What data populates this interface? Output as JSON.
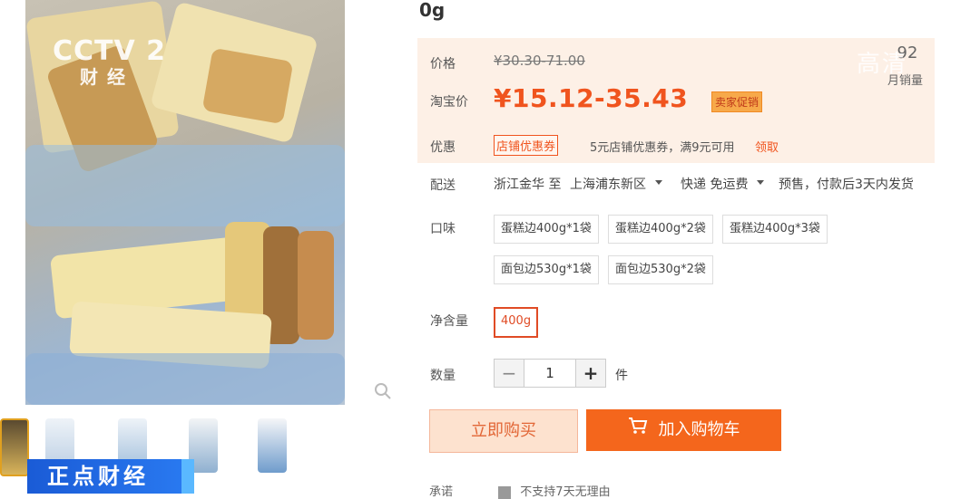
{
  "product": {
    "title_fragment": "0g"
  },
  "price": {
    "label": "价格",
    "original": "¥30.30-71.00",
    "taobao_label": "淘宝价",
    "taobao_price": "¥15.12-35.43",
    "seller_promo": "卖家促销"
  },
  "sales": {
    "count": "92",
    "label": "月销量"
  },
  "promotion": {
    "label": "优惠",
    "tag": "店铺优惠券",
    "description": "5元店铺优惠券，满9元可用",
    "claim": "领取"
  },
  "delivery": {
    "label": "配送",
    "from": "浙江金华 至",
    "to": "上海浦东新区",
    "method": "快递 免运费",
    "presale": "预售，付款后3天内发货"
  },
  "flavor": {
    "label": "口味",
    "options": [
      "蛋糕边400g*1袋",
      "蛋糕边400g*2袋",
      "蛋糕边400g*3袋",
      "面包边530g*1袋",
      "面包边530g*2袋"
    ]
  },
  "net_weight": {
    "label": "净含量",
    "options": [
      "400g"
    ]
  },
  "quantity": {
    "label": "数量",
    "value": "1",
    "unit": "件",
    "minus": "−",
    "plus": "+"
  },
  "actions": {
    "buy_now": "立即购买",
    "add_to_cart": "加入购物车"
  },
  "overlay": {
    "channel_logo": "CCTV 2",
    "channel_sub": "财经",
    "program_banner": "正点财经",
    "watermark": "高清"
  },
  "footer": {
    "commitment_label": "承诺",
    "return_policy": "不支持7天无理由"
  },
  "colors": {
    "accent": "#f0541e",
    "cart_button": "#f4661c",
    "price_bg": "#fdf0e6",
    "banner_blue": "#1a5bd6"
  }
}
